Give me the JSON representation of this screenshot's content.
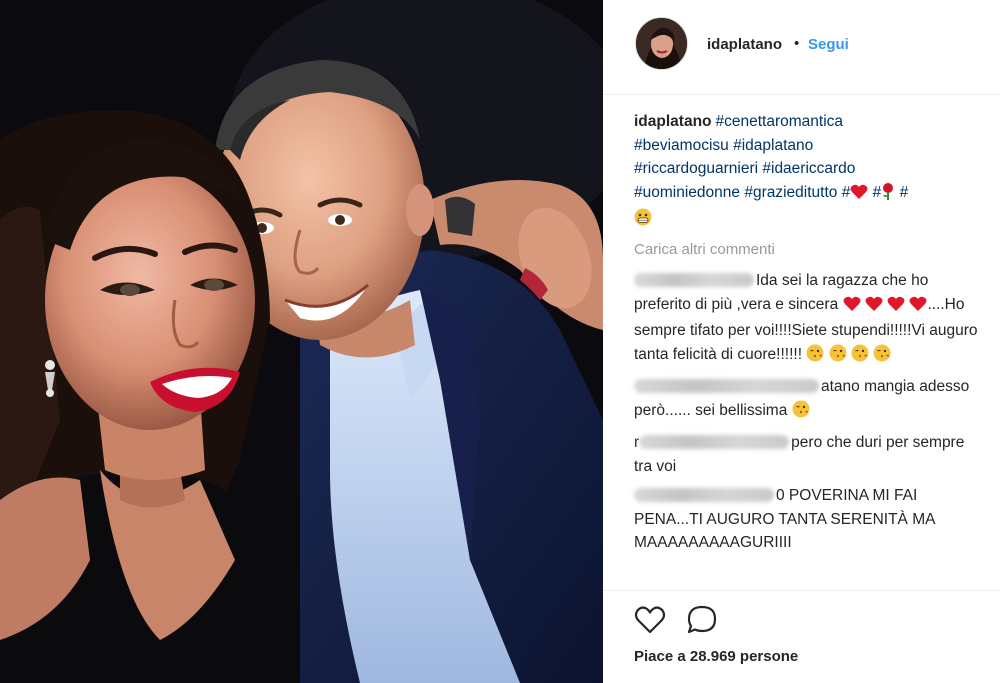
{
  "post": {
    "username": "idaplatano",
    "follow_separator": "•",
    "follow_label": "Segui"
  },
  "caption": {
    "username": "idaplatano",
    "hashtags": [
      "#cenettaromantica",
      "#beviamocisu",
      "#idaplatano",
      "#riccardoguarnieri",
      "#idaericcardo",
      "#uominiedonne",
      "#grazieditutto",
      "#",
      "#",
      "#"
    ]
  },
  "load_more_label": "Carica altri commenti",
  "comments": [
    {
      "text_1": "Ida sei la ragazza che ho preferito di più ,vera e sincera",
      "text_2": "....Ho sempre tifato per voi!!!!Siete stupendi!!!!!Vi auguro tanta felicità di cuore!!!!!!"
    },
    {
      "text_1": "atano mangia adesso però...... sei bellissima"
    },
    {
      "text_1": "r",
      "text_2": "pero che duri per sempre tra voi"
    },
    {
      "text_1": "0 POVERINA MI FAI PENA...TI AUGURO TANTA SERENITÀ MA MAAAAAAAAAGURIIII"
    }
  ],
  "likes_text": "Piace a 28.969 persone",
  "icons": {
    "like": "heart-outline-icon",
    "comment": "speech-bubble-icon"
  },
  "colors": {
    "link": "#3897f0",
    "hashtag": "#003569",
    "muted": "#999999",
    "heart": "#e0162b"
  }
}
